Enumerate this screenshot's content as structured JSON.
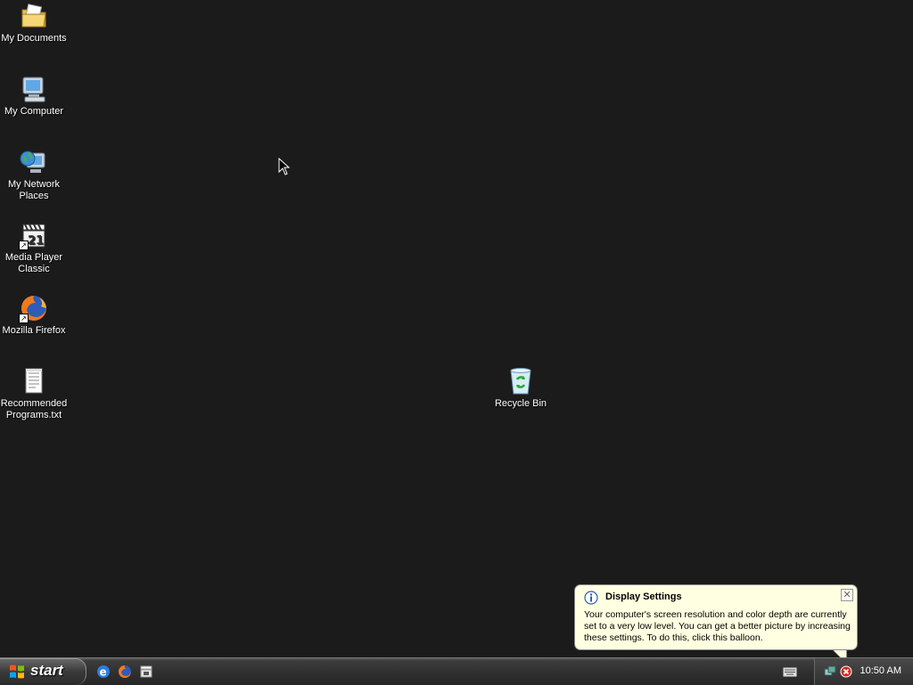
{
  "desktop": {
    "icons": [
      {
        "label": "My Documents",
        "icon": "folder-documents-icon"
      },
      {
        "label": "My Computer",
        "icon": "computer-icon"
      },
      {
        "label": "My Network Places",
        "icon": "network-places-icon"
      },
      {
        "label": "Media Player Classic",
        "icon": "media-player-icon"
      },
      {
        "label": "Mozilla Firefox",
        "icon": "firefox-icon"
      },
      {
        "label": "Recommended Programs.txt",
        "icon": "text-file-icon"
      },
      {
        "label": "Recycle Bin",
        "icon": "recycle-bin-icon"
      }
    ]
  },
  "taskbar": {
    "start_label": "start",
    "quick_launch": [
      "internet-explorer-icon",
      "firefox-icon",
      "media-player-icon"
    ],
    "clock": "10:50 AM"
  },
  "balloon": {
    "title": "Display Settings",
    "body": "Your computer's screen resolution and color depth are currently set to a very low level. You can get a better picture by increasing these settings. To do this, click this balloon.",
    "close_glyph": "✕"
  },
  "colors": {
    "desktop_bg": "#1b1b1b",
    "balloon_bg": "#ffffe1"
  }
}
